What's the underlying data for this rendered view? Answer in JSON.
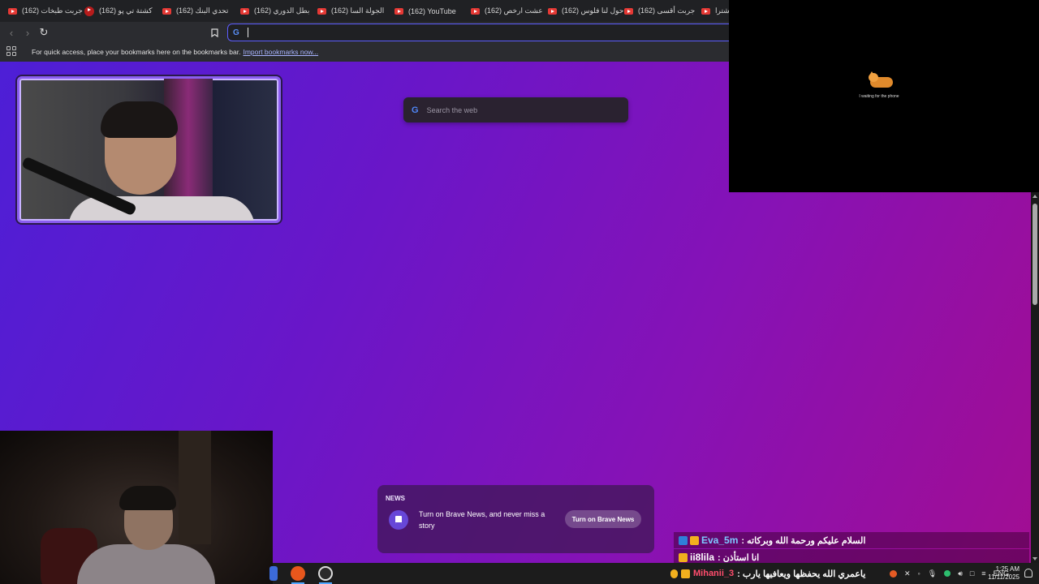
{
  "tabs": [
    {
      "label": "(162) جربت طبخات"
    },
    {
      "label": "(162) كشتة تي پو"
    },
    {
      "label": "(162) تحدي البنك"
    },
    {
      "label": "(162) بطل الدوري"
    },
    {
      "label": "(162) الجولة السا"
    },
    {
      "label": "(162) YouTube"
    },
    {
      "label": "(162) عشت ارخص"
    },
    {
      "label": "(162) حول لنا فلوس"
    },
    {
      "label": "(162) جربت أقسى"
    },
    {
      "label": "اشترا"
    }
  ],
  "toolbar": {
    "omnibox_value": "",
    "search_engine_icon": "G"
  },
  "bookmarks_bar": {
    "hint": "For quick access, place your bookmarks here on the bookmarks bar.",
    "import_link": "Import bookmarks now..."
  },
  "newtab": {
    "search_placeholder": "Search the web",
    "search_engine_icon": "G",
    "news": {
      "label": "NEWS",
      "text": "Turn on Brave News, and never miss a story",
      "button": "Turn on Brave News"
    }
  },
  "overlay": {
    "waiting_text": "I waiting for the phone"
  },
  "chat": [
    {
      "user": "Eva_5m",
      "message": "السلام عليكم ورحمة الله وبركاته",
      "user_color": "#7ec8ff"
    },
    {
      "user": "ii8lila",
      "message": "انا استأذن",
      "user_color": "#ffffff"
    },
    {
      "user": "Mihanii_3",
      "message": "ياعمري الله يحفظها ويعافيها يارب",
      "user_color": "#ff4d6d"
    }
  ],
  "taskbar": {
    "language": "ENG",
    "time": "1:25 AM",
    "date": "11/11/2025"
  },
  "colors": {
    "accent": "#5d5dff",
    "gradient_start": "#4d1fd6",
    "gradient_end": "#a20d92",
    "youtube_red": "#e53935"
  }
}
